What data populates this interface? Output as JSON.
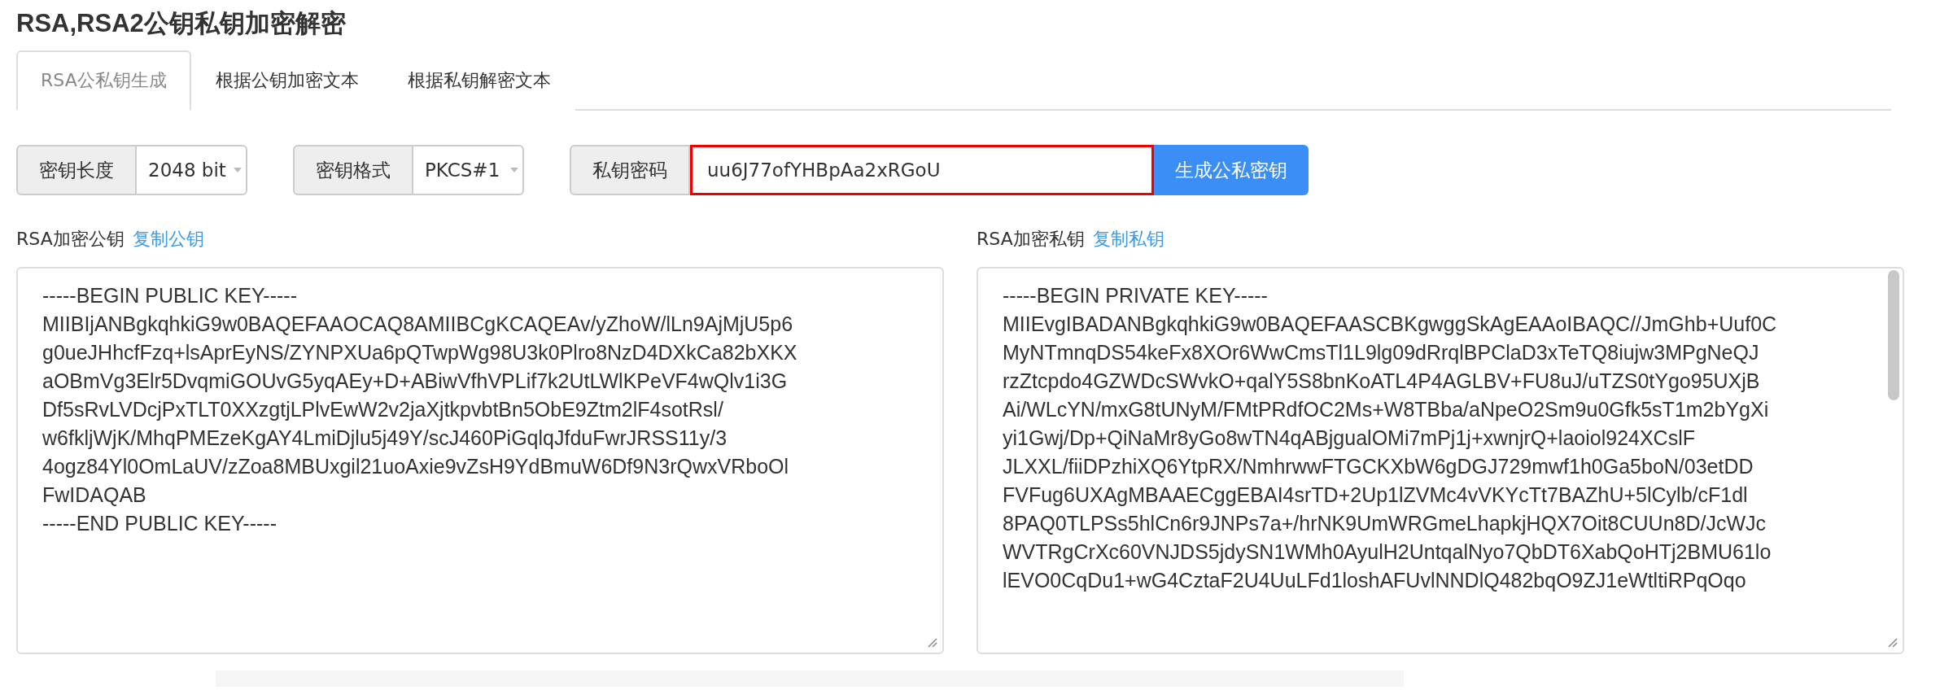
{
  "title": "RSA,RSA2公钥私钥加密解密",
  "tabs": [
    {
      "label": "RSA公私钥生成",
      "selected": true
    },
    {
      "label": "根据公钥加密文本",
      "selected": false
    },
    {
      "label": "根据私钥解密文本",
      "selected": false
    }
  ],
  "options": [
    {
      "kind": "select",
      "label": "密钥长度",
      "value": "2048 bit"
    },
    {
      "kind": "select",
      "label": "密钥格式",
      "value": "PKCS#1"
    },
    {
      "kind": "input",
      "label": "私钥密码",
      "value": "uu6J77ofYHBpAa2xRGoU",
      "focused": true
    }
  ],
  "generate_button": "生成公私密钥",
  "panels": [
    {
      "heading": "RSA加密公钥",
      "link": "复制公钥",
      "lines": [
        "-----BEGIN PUBLIC KEY-----",
        "MIIBIjANBgkqhkiG9w0BAQEFAAOCAQ8AMIIBCgKCAQEAv/yZhoW/lLn9AjMjU5p6",
        "g0ueJHhcfFzq+lsAprEyNS/ZYNPXUa6pQTwpWg98U3k0Plro8NzD4DXkCa82bXKX",
        "aOBmVg3Elr5DvqmiGOUvG5yqAEy+D+ABiwVfhVPLif7k2UtLWlKPeVF4wQlv1i3G",
        "Df5sRvLVDcjPxTLT0XXzgtjLPlvEwW2v2jaXjtkpvbtBn5ObE9Ztm2lF4sotRsl/",
        "w6fkljWjK/MhqPMEzeKgAY4LmiDjlu5j49Y/scJ460PiGqlqJfduFwrJRSS11y/3",
        "4ogz84Yl0OmLaUV/zZoa8MBUxgil21uoAxie9vZsH9YdBmuW6Df9N3rQwxVRboOl",
        "FwIDAQAB",
        "-----END PUBLIC KEY-----"
      ]
    },
    {
      "heading": "RSA加密私钥",
      "link": "复制私钥",
      "lines": [
        "-----BEGIN PRIVATE KEY-----",
        "MIIEvgIBADANBgkqhkiG9w0BAQEFAASCBKgwggSkAgEAAoIBAQC//JmGhb+Uuf0C",
        "MyNTmnqDS54keFx8XOr6WwCmsTl1L9lg09dRrqlBPClaD3xTeTQ8iujw3MPgNeQJ",
        "rzZtcpdo4GZWDcSWvkO+qalY5S8bnKoATL4P4AGLBV+FU8uJ/uTZS0tYgo95UXjB",
        "Ai/WLcYN/mxG8tUNyM/FMtPRdfOC2Ms+W8TBba/aNpeO2Sm9u0Gfk5sT1m2bYgXi",
        "yi1Gwj/Dp+QiNaMr8yGo8wTN4qABjgualOMi7mPj1j+xwnjrQ+laoiol924XCslF",
        "JLXXL/fiiDPzhiXQ6YtpRX/NmhrwwFTGCKXbW6gDGJ729mwf1h0Ga5boN/03etDD",
        "FVFug6UXAgMBAAECggEBAI4srTD+2Up1lZVMc4vVKYcTt7BAZhU+5lCylb/cF1dl",
        "8PAQ0TLPSs5hlCn6r9JNPs7a+/hrNK9UmWRGmeLhapkjHQX7Oit8CUUn8D/JcWJc",
        "WVTRgCrXc60VNJDS5jdySN1WMh0AyulH2UntqalNyo7QbDT6XabQoHTj2BMU61lo",
        "lEVO0CqDu1+wG4CztaF2U4UuLFd1loshAFUvlNNDlQ482bqO9ZJ1eWtltiRPqOqo"
      ]
    }
  ]
}
